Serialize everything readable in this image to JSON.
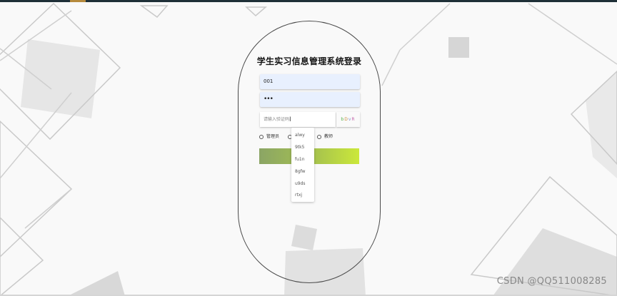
{
  "page": {
    "title": "学生实习信息管理系统登录"
  },
  "form": {
    "username_value": "001",
    "password_value": "•••",
    "captcha_placeholder": "请输入验证码",
    "captcha_chars": [
      "b",
      "D",
      "v",
      "R"
    ],
    "roles": [
      "管理员",
      "",
      "教师"
    ]
  },
  "autocomplete": {
    "items": [
      "alwy",
      "9tk5",
      "fu1n",
      "8gfw",
      "u9ds",
      "rtxj"
    ]
  },
  "watermark": "CSDN @QQ511008285",
  "colors": {
    "button_start": "#8ba565",
    "button_end": "#cbe83a",
    "field_bg": "#e8f0fe",
    "pill_border": "#4a4a4a"
  }
}
